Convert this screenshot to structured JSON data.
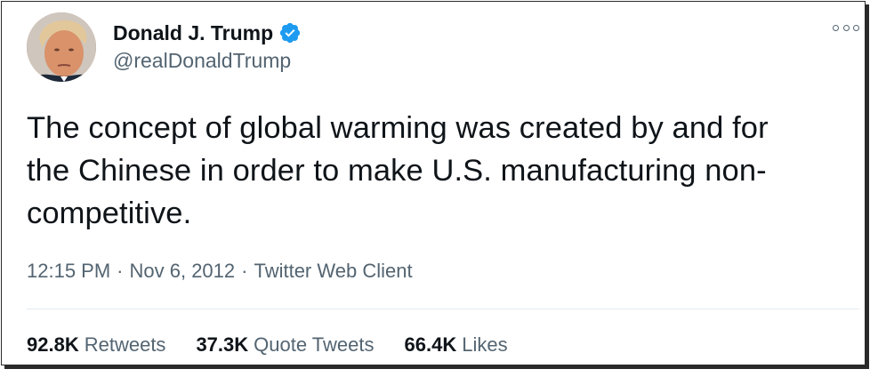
{
  "author": {
    "display_name": "Donald J. Trump",
    "handle": "@realDonaldTrump",
    "verified_badge_icon": "verified-badge-icon",
    "avatar_icon": "profile-photo"
  },
  "menu": {
    "icon": "more-options-icon"
  },
  "tweet": {
    "text": "The concept of global warming was created by and for\nthe Chinese in order to make U.S. manufacturing non-\ncompetitive."
  },
  "meta": {
    "time": "12:15 PM",
    "separator": "·",
    "date": "Nov 6, 2012",
    "source": "Twitter Web Client"
  },
  "stats": {
    "retweets": {
      "count": "92.8K",
      "label": "Retweets"
    },
    "quote_tweets": {
      "count": "37.3K",
      "label": "Quote Tweets"
    },
    "likes": {
      "count": "66.4K",
      "label": "Likes"
    }
  },
  "colors": {
    "text_primary": "#0f1419",
    "text_secondary": "#536471",
    "verified_blue": "#1d9bf0",
    "divider": "#e6ecf0"
  }
}
